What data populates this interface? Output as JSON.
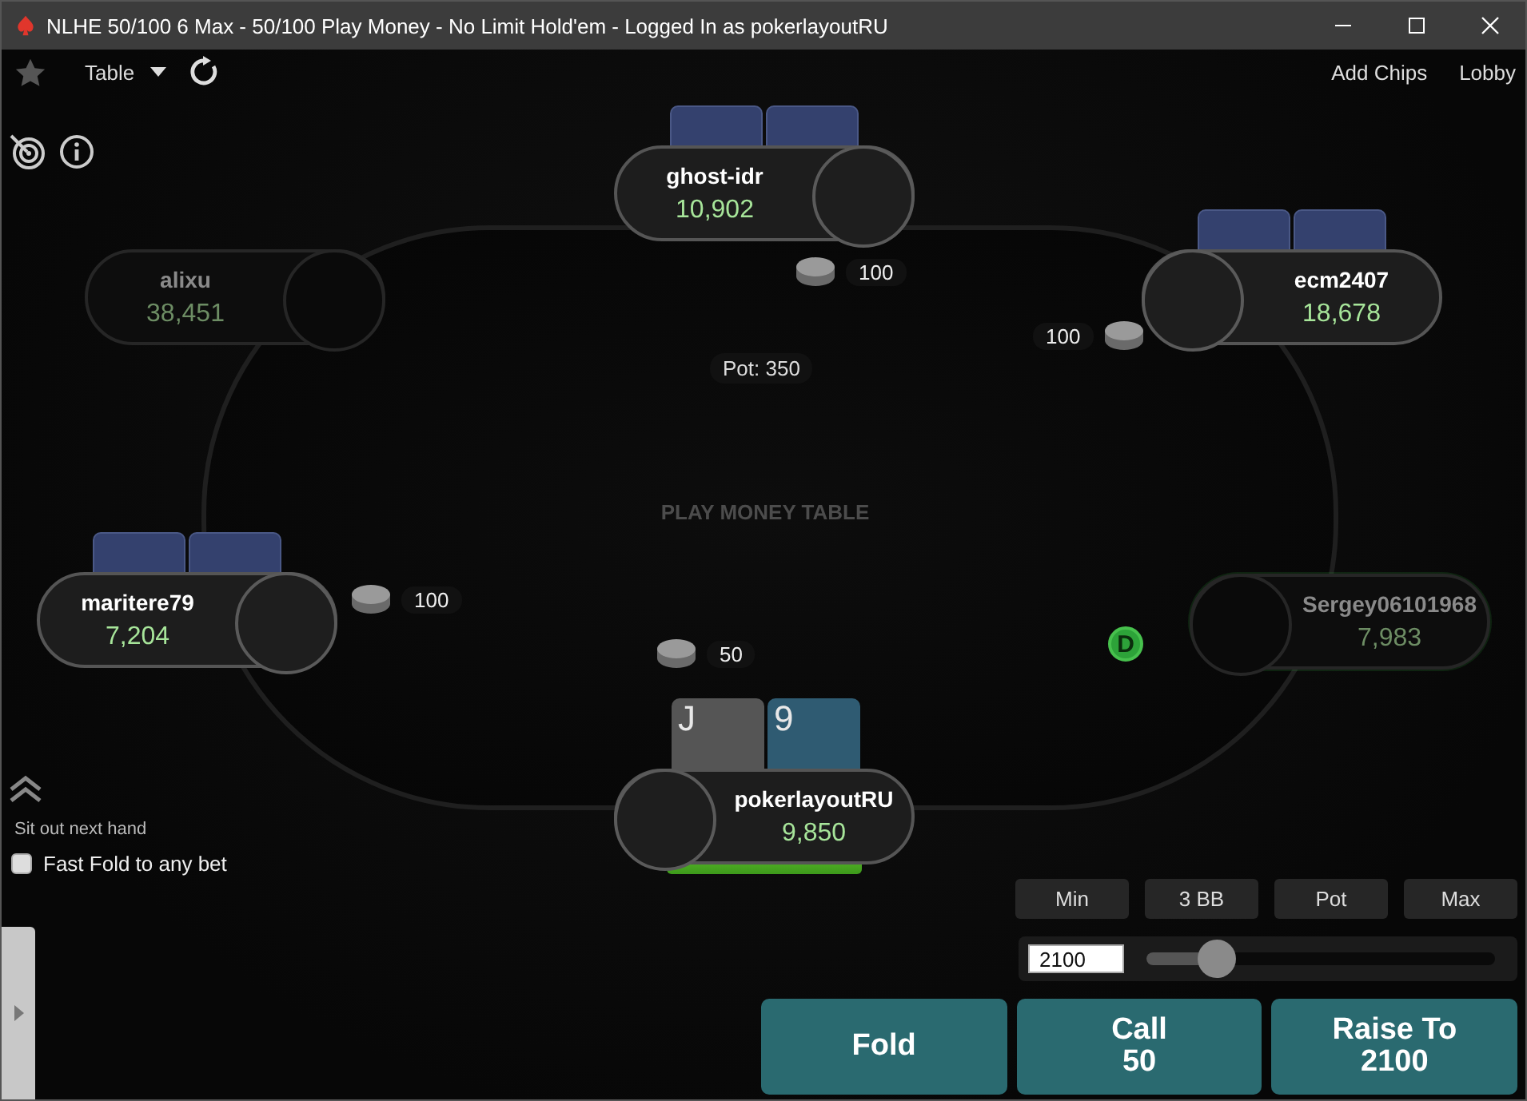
{
  "window": {
    "title": "NLHE 50/100 6 Max - 50/100 Play Money - No Limit Hold'em - Logged In as pokerlayoutRU"
  },
  "toolbar": {
    "menu": "Table",
    "links": [
      "Add Chips",
      "Lobby"
    ]
  },
  "table": {
    "label": "PLAY MONEY TABLE",
    "pot": "Pot: 350",
    "dealer_button": "D"
  },
  "players": [
    {
      "name": "alixu",
      "stack": "38,451",
      "folded": true,
      "has_cards": false,
      "dealer": false
    },
    {
      "name": "ghost-idr",
      "stack": "10,902",
      "folded": false,
      "has_cards": true,
      "bet": "100",
      "dealer": false
    },
    {
      "name": "ecm2407",
      "stack": "18,678",
      "folded": false,
      "has_cards": true,
      "bet": "100",
      "dealer": false
    },
    {
      "name": "maritere79",
      "stack": "7,204",
      "folded": false,
      "has_cards": true,
      "bet": "100",
      "dealer": false
    },
    {
      "name": "Sergey06101968",
      "stack": "7,983",
      "folded": true,
      "has_cards": false,
      "dealer": true
    },
    {
      "name": "pokerlayoutRU",
      "stack": "9,850",
      "folded": false,
      "has_cards": false,
      "bet": "50",
      "dealer": false,
      "cards": [
        {
          "rank": "J",
          "color": "#555555"
        },
        {
          "rank": "9",
          "color": "#2f5b72"
        }
      ],
      "timer": {
        "level": 1
      }
    }
  ],
  "options": {
    "sit_out": "Sit out next hand",
    "fast_fold": {
      "label": "Fast Fold to any bet",
      "checked": false
    }
  },
  "bet_presets": [
    "Min",
    "3 BB",
    "Pot",
    "Max"
  ],
  "bet_input": {
    "value": "2100",
    "level": 0.2
  },
  "actions": [
    {
      "label": "Fold"
    },
    {
      "label": "Call",
      "amount": "50"
    },
    {
      "label": "Raise To",
      "amount": "2100"
    }
  ]
}
